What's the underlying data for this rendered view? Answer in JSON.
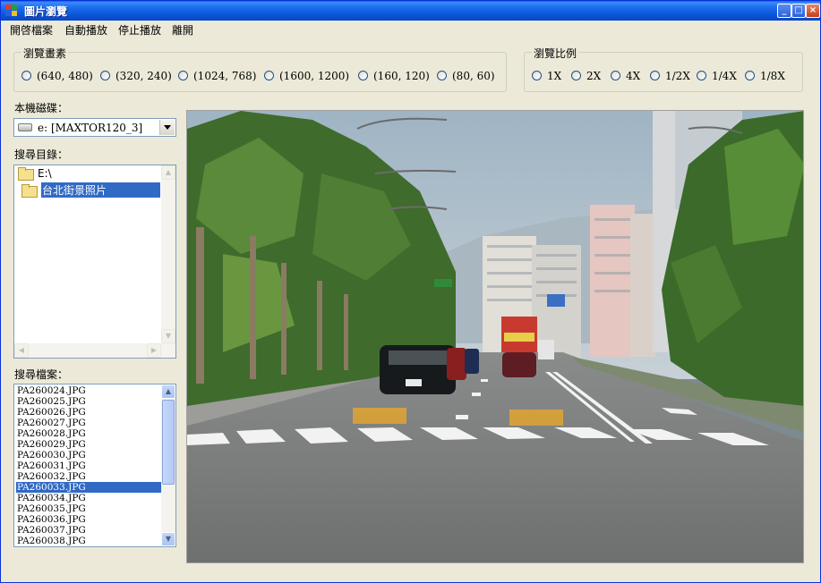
{
  "window": {
    "title": "圖片瀏覽",
    "buttons": {
      "minimize": "_",
      "maximize": "□",
      "close": "×"
    }
  },
  "menu": [
    "開啓檔案",
    "自動播放",
    "停止播放",
    "離開"
  ],
  "resolution_group": {
    "title": "瀏覽畫素",
    "options": [
      "(640, 480)",
      "(320, 240)",
      "(1024, 768)",
      "(1600, 1200)",
      "(160, 120)",
      "(80, 60)"
    ]
  },
  "scale_group": {
    "title": "瀏覽比例",
    "options": [
      "1X",
      "2X",
      "4X",
      "1/2X",
      "1/4X",
      "1/8X"
    ]
  },
  "drive": {
    "label": "本機磁碟：",
    "value": "e: [MAXTOR120_3]"
  },
  "directory": {
    "label": "搜尋目錄：",
    "nodes": [
      "E:\\",
      "台北街景照片"
    ],
    "selected_index": 1
  },
  "files": {
    "label": "搜尋檔案：",
    "items": [
      "PA260024.JPG",
      "PA260025.JPG",
      "PA260026.JPG",
      "PA260027.JPG",
      "PA260028.JPG",
      "PA260029.JPG",
      "PA260030.JPG",
      "PA260031.JPG",
      "PA260032.JPG",
      "PA260033.JPG",
      "PA260034.JPG",
      "PA260035.JPG",
      "PA260036.JPG",
      "PA260037.JPG",
      "PA260038.JPG"
    ],
    "selected": "PA260033.JPG"
  },
  "scroll_arrows": {
    "up": "▲",
    "down": "▼",
    "left": "◀",
    "right": "▶"
  },
  "colors": {
    "titlebar": "#0a55d8",
    "selection": "#316ac5",
    "window_bg": "#ece9d8"
  }
}
